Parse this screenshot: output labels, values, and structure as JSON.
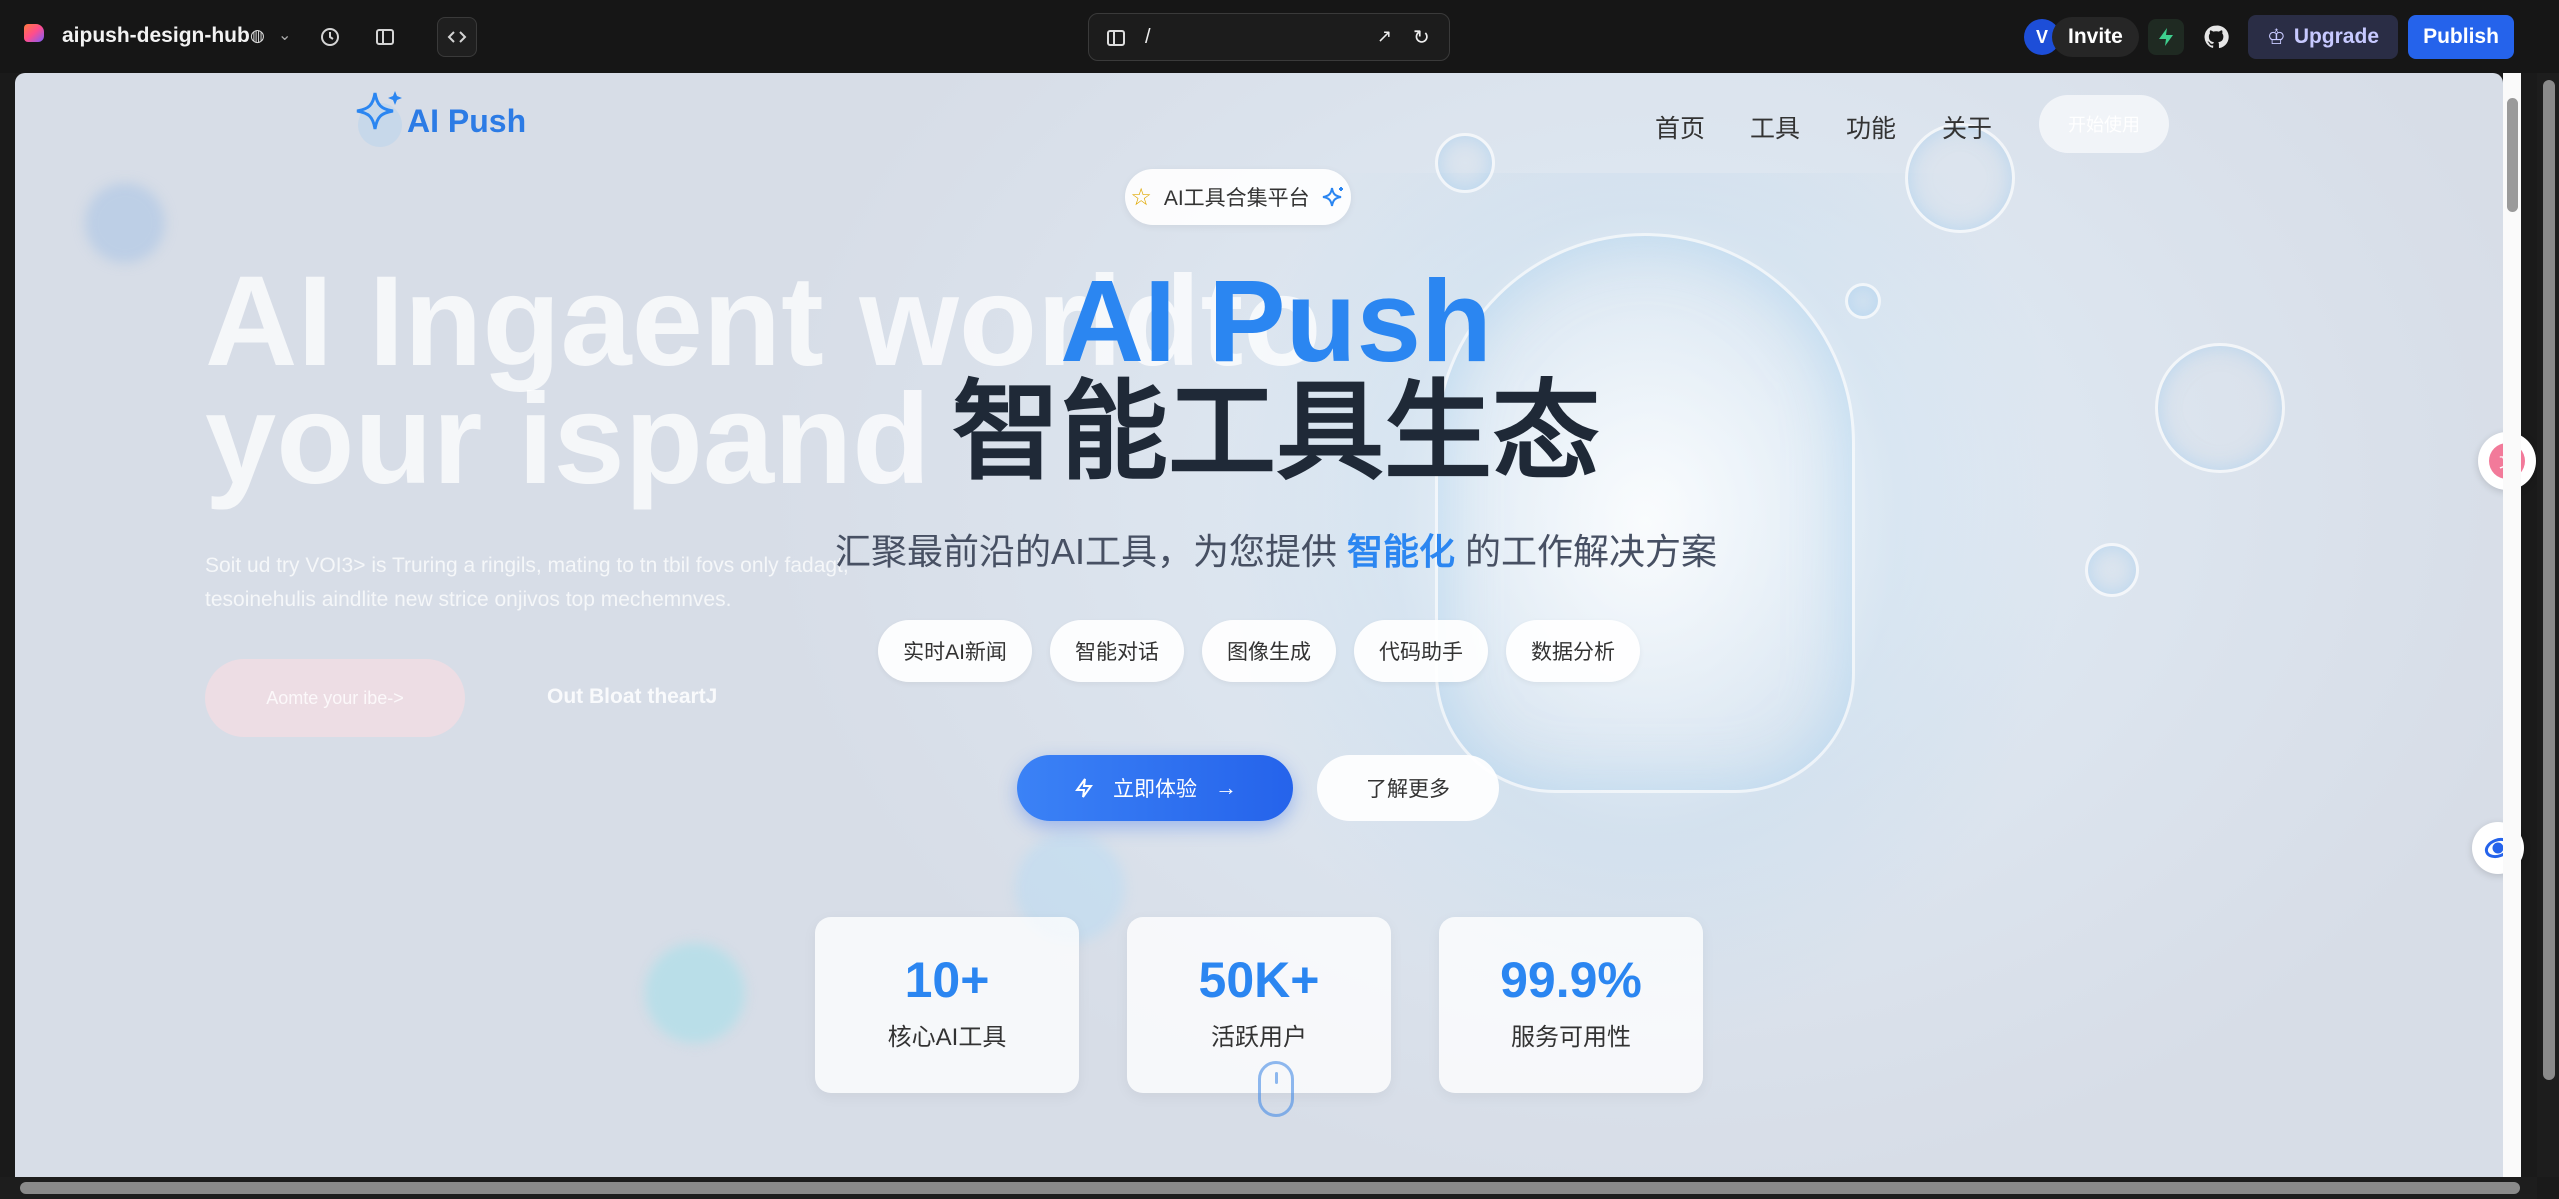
{
  "editor": {
    "project_name": "aipush-design-hub",
    "url_path": "/",
    "avatar_initial": "V",
    "invite_label": "Invite",
    "upgrade_label": "Upgrade",
    "publish_label": "Publish"
  },
  "site": {
    "logo_text": "AI Push",
    "nav": [
      "首页",
      "工具",
      "功能",
      "关于"
    ],
    "cta_label": "开始使用",
    "badge_label": "AI工具合集平台",
    "hero_brand": "AI Push",
    "hero_title": "智能工具生态",
    "subtitle_before": "汇聚最前沿的AI工具，为您提供",
    "subtitle_highlight": "智能化",
    "subtitle_after": "的工作解决方案",
    "chips": [
      "实时AI新闻",
      "智能对话",
      "图像生成",
      "代码助手",
      "数据分析"
    ],
    "primary_button": "立即体验",
    "secondary_button": "了解更多",
    "stats": [
      {
        "value": "10+",
        "label": "核心AI工具"
      },
      {
        "value": "50K+",
        "label": "活跃用户"
      },
      {
        "value": "99.9%",
        "label": "服务可用性"
      }
    ]
  },
  "background_ghost": {
    "headline_line1": "AI  Ingaent worldto",
    "headline_line2": "your ispand",
    "para_line1": "Soit ud try VOI3> is Truring a ringils, mating to tn tbil fovs only fadagt,",
    "para_line2": "tesoinehulis aindlite new strice onjivos top mechemnves.",
    "button1": "Aomte your ibe->",
    "button2": "Out Bloat theartJ"
  },
  "colors": {
    "brand_blue": "#2b86f1",
    "publish_blue": "#2563eb",
    "title_dark": "#1f2937"
  }
}
